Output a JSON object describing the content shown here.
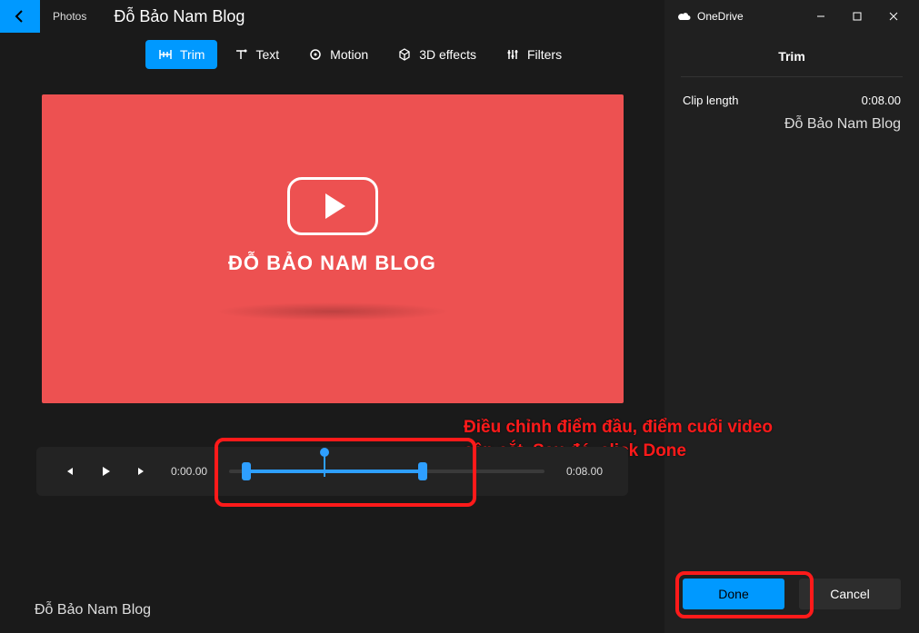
{
  "titlebar": {
    "app_name": "Photos",
    "project_title": "Đỗ Bảo Nam Blog",
    "onedrive": "OneDrive"
  },
  "toolbar": {
    "trim": "Trim",
    "text": "Text",
    "motion": "Motion",
    "effects": "3D effects",
    "filters": "Filters"
  },
  "video": {
    "title": "ĐỖ BẢO NAM BLOG"
  },
  "transport": {
    "start_time": "0:00.00",
    "end_time": "0:08.00"
  },
  "annotation": {
    "text": "Điều chỉnh điểm đầu, điểm cuối video cần cắt. Sau đó, click Done"
  },
  "watermark": "Đỗ Bảo Nam Blog",
  "sidebar": {
    "panel_title": "Trim",
    "clip_length_label": "Clip length",
    "clip_length_value": "0:08.00",
    "brand": "Đỗ Bảo Nam Blog",
    "done": "Done",
    "cancel": "Cancel"
  }
}
